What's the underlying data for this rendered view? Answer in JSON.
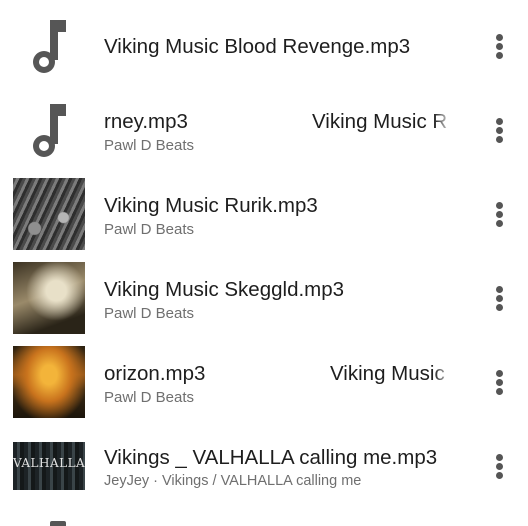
{
  "tracks": [
    {
      "title": "Viking Music Blood Revenge.mp3",
      "subtitle": "",
      "art": "music-note-icon"
    },
    {
      "title_marquee_a": "rney.mp3",
      "title_marquee_b": "Viking Music R",
      "subtitle": "Pawl D Beats",
      "art": "music-note-icon"
    },
    {
      "title": "Viking Music Rurik.mp3",
      "subtitle": "Pawl D Beats",
      "art": "album-art"
    },
    {
      "title": "Viking Music Skeggld.mp3",
      "subtitle": "Pawl D Beats",
      "art": "album-art"
    },
    {
      "title_marquee_a": "orizon.mp3",
      "title_marquee_b": "Viking Music",
      "subtitle": "Pawl D Beats",
      "art": "album-art"
    },
    {
      "title": "Vikings _ VALHALLA calling me.mp3",
      "subtitle": "JeyJey · Vikings / VALHALLA calling me",
      "art": "album-art",
      "art_text": "VALHALLA"
    }
  ],
  "colors": {
    "icon": "#565656",
    "title": "#1e1e1e",
    "subtitle": "#6f6f6f",
    "menu_dots": "#555555"
  }
}
